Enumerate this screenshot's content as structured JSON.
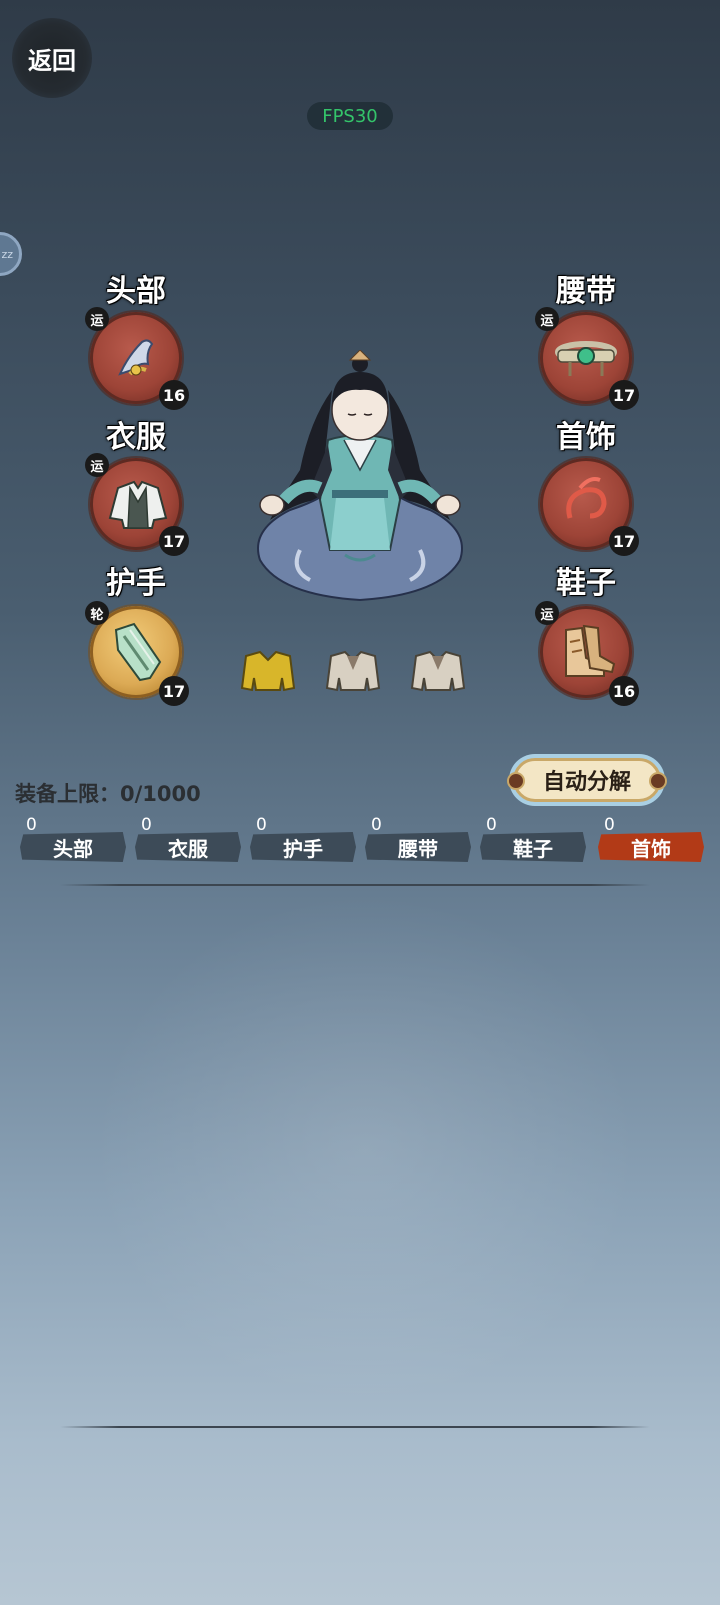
{
  "header": {
    "back_label": "返回",
    "fps": "FPS30",
    "side_label": "zz"
  },
  "slots": {
    "head": {
      "title": "头部",
      "badge": "运",
      "level": "16"
    },
    "clothes": {
      "title": "衣服",
      "badge": "运",
      "level": "17"
    },
    "gloves": {
      "title": "护手",
      "badge": "轮",
      "level": "17"
    },
    "belt": {
      "title": "腰带",
      "badge": "运",
      "level": "17"
    },
    "accessory": {
      "title": "首饰",
      "level": "17"
    },
    "shoes": {
      "title": "鞋子",
      "badge": "运",
      "level": "16"
    }
  },
  "outfits": [
    {
      "icon": "yellow-robe-icon",
      "color": "#d8b62a"
    },
    {
      "icon": "white-robe-icon",
      "color": "#d8d0c2"
    },
    {
      "icon": "white-robe-icon",
      "color": "#d8d0c2"
    }
  ],
  "inventory": {
    "limit_label": "装备上限：",
    "limit_value": "0/1000",
    "auto_decompose_label": "自动分解"
  },
  "tabs": [
    {
      "label": "头部",
      "count": "0"
    },
    {
      "label": "衣服",
      "count": "0"
    },
    {
      "label": "护手",
      "count": "0"
    },
    {
      "label": "腰带",
      "count": "0"
    },
    {
      "label": "鞋子",
      "count": "0"
    },
    {
      "label": "首饰",
      "count": "0",
      "active": true
    }
  ],
  "colors": {
    "accent_red": "#b23a17",
    "fps_green": "#34c46a",
    "slot_red": "#9d4437",
    "slot_gold": "#dcaa55"
  }
}
